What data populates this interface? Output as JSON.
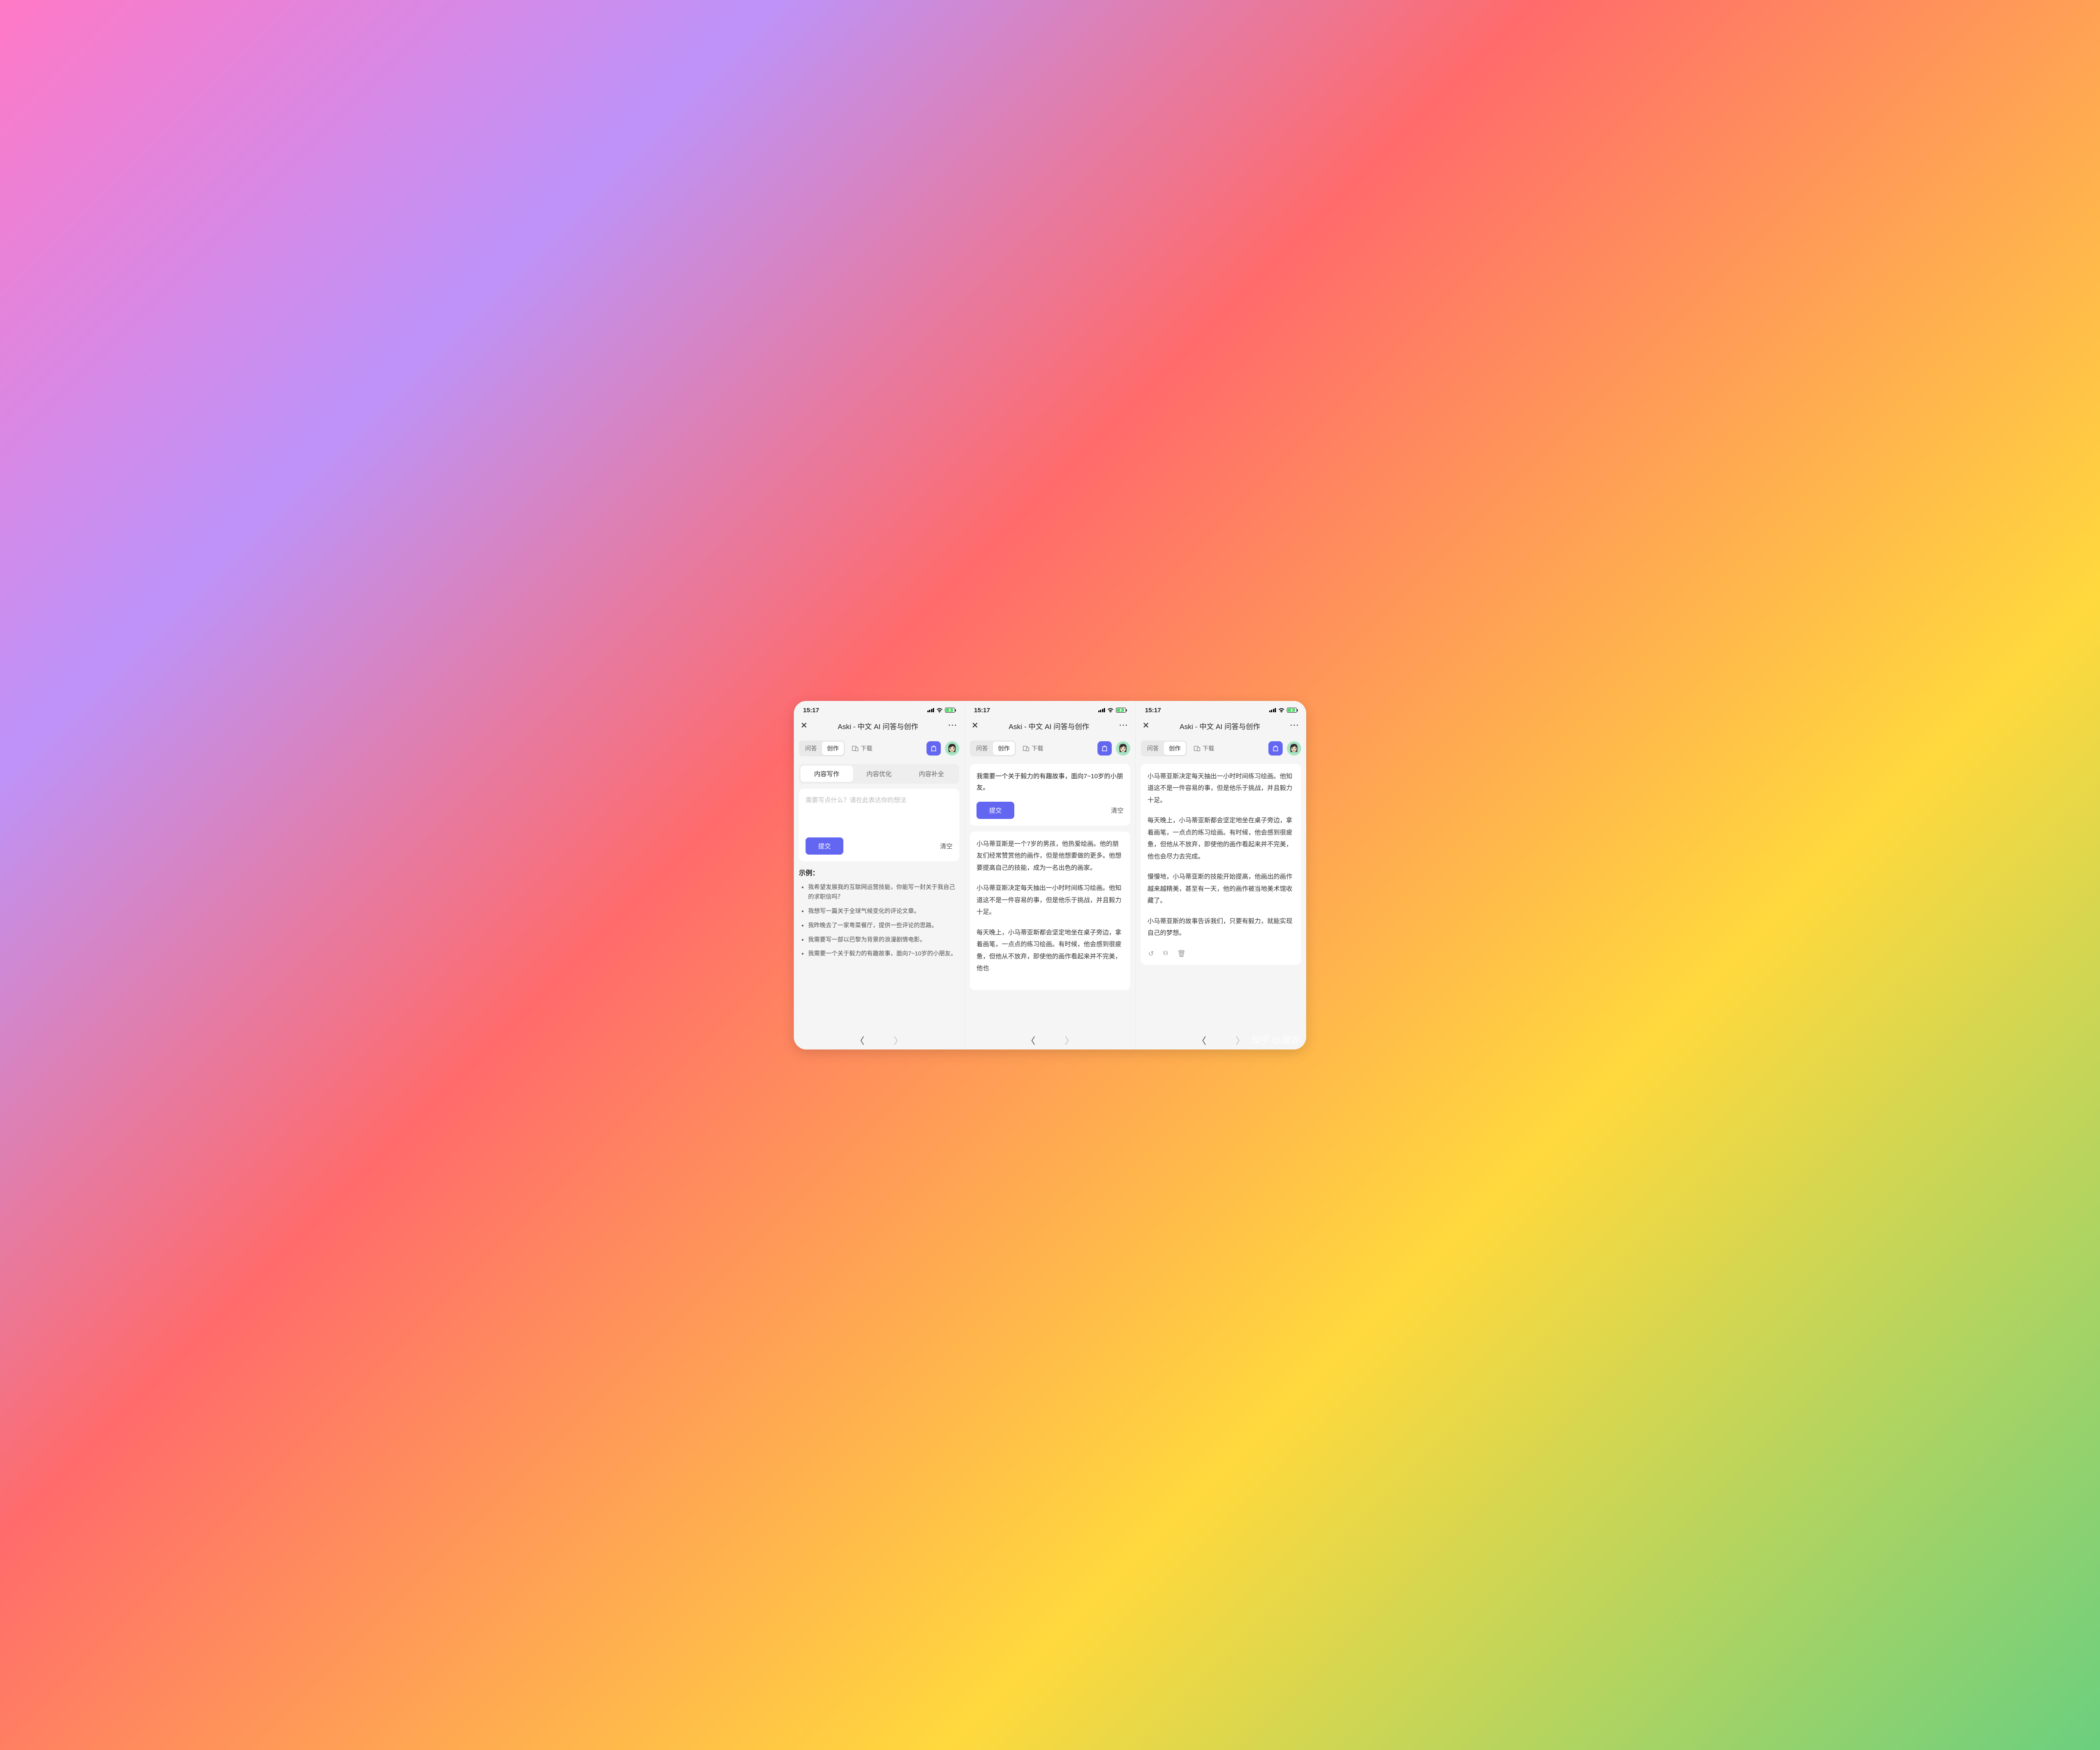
{
  "status": {
    "time": "15:17"
  },
  "nav": {
    "title": "Aski - 中文 AI 问答与创作"
  },
  "toolbar": {
    "tab_qa": "问答",
    "tab_create": "创作",
    "download": "下载"
  },
  "subtabs": {
    "write": "内容写作",
    "optimize": "内容优化",
    "complete": "内容补全"
  },
  "input": {
    "placeholder": "需要写点什么？请在此表达你的想法",
    "filled_prompt": "我需要一个关于毅力的有趣故事，面向7~10岁的小朋友。"
  },
  "buttons": {
    "submit": "提交",
    "clear": "清空"
  },
  "examples": {
    "heading": "示例：",
    "items": [
      "我希望发展我的互联网运营技能，你能写一封关于我自己的求职信吗？",
      "我想写一篇关于全球气候变化的评论文章。",
      "我昨晚去了一家粤菜餐厅，提供一些评论的思路。",
      "我需要写一部以巴黎为背景的浪漫剧情电影。",
      "我需要一个关于毅力的有趣故事，面向7~10岁的小朋友。"
    ]
  },
  "story": {
    "p1": "小马蒂亚斯是一个7岁的男孩，他热爱绘画。他的朋友们经常赞赏他的画作，但是他想要做的更多。他想要提高自己的技能，成为一名出色的画家。",
    "p2": "小马蒂亚斯决定每天抽出一小时时间练习绘画。他知道这不是一件容易的事，但是他乐于挑战，并且毅力十足。",
    "p3": "每天晚上，小马蒂亚斯都会坚定地坐在桌子旁边，拿着画笔，一点点的练习绘画。有时候，他会感到很疲惫，但他从不放弃，即使他的画作看起来并不完美，他也会尽力去完成。",
    "p4": "慢慢地，小马蒂亚斯的技能开始提高，他画出的画作越来越精美，甚至有一天，他的画作被当地美术馆收藏了。",
    "p5": "小马蒂亚斯的故事告诉我们，只要有毅力，就能实现自己的梦想。",
    "p3_trunc": "每天晚上，小马蒂亚斯都会坚定地坐在桌子旁边，拿着画笔，一点点的练习绘画。有时候，他会感到很疲惫，但他从不放弃，即使他的画作看起来并不完美，他也"
  },
  "watermark": "知乎 @滕菲"
}
